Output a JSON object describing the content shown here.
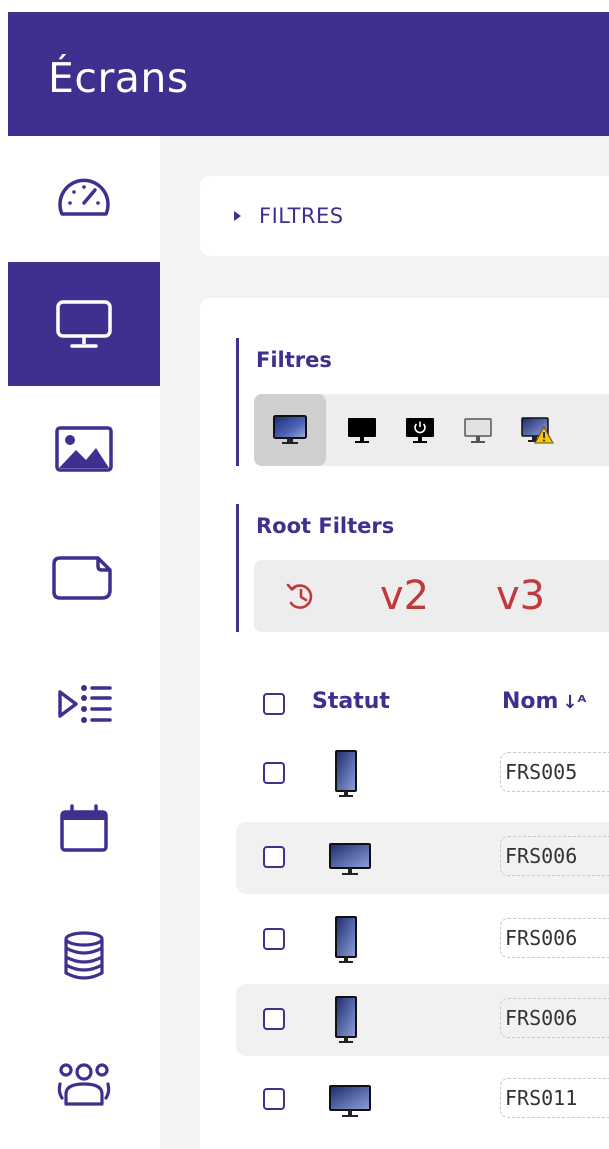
{
  "header": {
    "title": "Écrans"
  },
  "sidebar": {
    "items": [
      {
        "icon": "dashboard-gauge-icon",
        "active": false
      },
      {
        "icon": "monitor-icon",
        "active": true
      },
      {
        "icon": "image-icon",
        "active": false
      },
      {
        "icon": "page-icon",
        "active": false
      },
      {
        "icon": "playlist-icon",
        "active": false
      },
      {
        "icon": "calendar-icon",
        "active": false
      },
      {
        "icon": "database-icon",
        "active": false
      },
      {
        "icon": "users-group-icon",
        "active": false
      }
    ]
  },
  "filters_panel": {
    "label": "FILTRES"
  },
  "filtres_group": {
    "title": "Filtres",
    "chips": [
      {
        "icon": "screen-all-icon",
        "selected": true
      },
      {
        "icon": "screen-black-icon",
        "selected": false
      },
      {
        "icon": "screen-power-icon",
        "selected": false
      },
      {
        "icon": "screen-off-icon",
        "selected": false
      },
      {
        "icon": "screen-warning-icon",
        "selected": false
      }
    ]
  },
  "root_filters": {
    "title": "Root Filters",
    "buttons": [
      {
        "icon": "history-icon",
        "label": ""
      },
      {
        "label": "v2"
      },
      {
        "label": "v3"
      }
    ]
  },
  "table": {
    "columns": {
      "status": "Statut",
      "name": "Nom"
    },
    "rows": [
      {
        "orientation": "portrait",
        "name": "FRS005"
      },
      {
        "orientation": "landscape",
        "name": "FRS006"
      },
      {
        "orientation": "portrait",
        "name": "FRS006"
      },
      {
        "orientation": "portrait",
        "name": "FRS006"
      },
      {
        "orientation": "landscape",
        "name": "FRS011"
      }
    ]
  },
  "colors": {
    "brand": "#3f2f8f",
    "root_filter": "#c0393b",
    "background": "#f3f2f5"
  }
}
